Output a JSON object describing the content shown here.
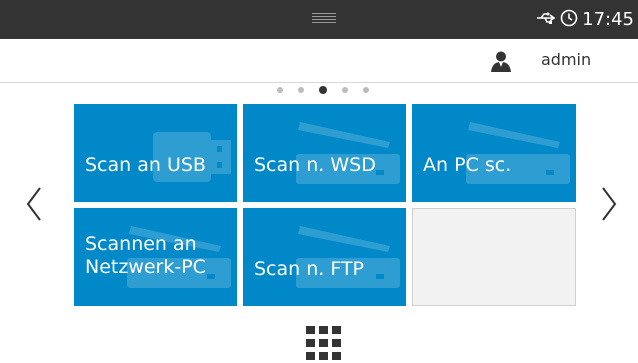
{
  "status_bar": {
    "time": "17:45",
    "icons": [
      "usb-icon",
      "clock-icon"
    ]
  },
  "user": {
    "name": "admin",
    "icon": "user-icon"
  },
  "pager": {
    "pages": 5,
    "active_index": 2
  },
  "tiles": [
    {
      "label": "Scan an USB",
      "icon": "usb-stick-icon",
      "color": "#0088c9"
    },
    {
      "label": "Scan n. WSD",
      "icon": "scanner-icon",
      "color": "#0088c9"
    },
    {
      "label": "An PC sc.",
      "icon": "scanner-icon",
      "color": "#0088c9"
    },
    {
      "label": "Scannen an\nNetzwerk-PC",
      "icon": "scanner-icon",
      "color": "#0088c9"
    },
    {
      "label": "Scan n. FTP",
      "icon": "scanner-icon",
      "color": "#0088c9"
    },
    {
      "label": "",
      "icon": "",
      "color": "#f2f2f2"
    }
  ],
  "navigation": {
    "prev_icon": "chevron-left-icon",
    "next_icon": "chevron-right-icon",
    "apps_icon": "apps-grid-icon"
  },
  "colors": {
    "status_bar": "#333333",
    "tile": "#0088c9"
  }
}
